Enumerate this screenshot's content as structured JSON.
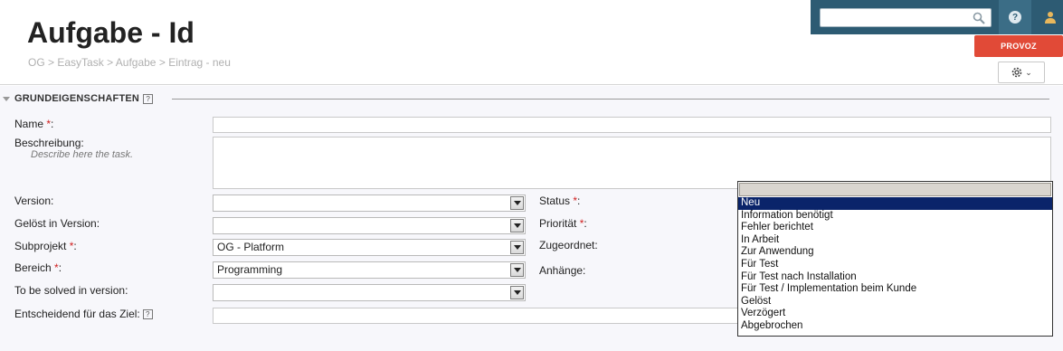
{
  "page": {
    "title": "Aufgabe - Id",
    "breadcrumb": [
      "OG",
      "EasyTask",
      "Aufgabe",
      "Eintrag - neu"
    ],
    "breadcrumb_separator": ">"
  },
  "topbar": {
    "search_placeholder": "",
    "help_icon": "question-circle-icon",
    "user_icon": "user-icon",
    "environment_badge": "PROVOZ",
    "gear_icon": "gear-icon"
  },
  "section": {
    "title": "GRUNDEIGENSCHAFTEN",
    "help_glyph": "?"
  },
  "fields": {
    "name": {
      "label": "Name",
      "required": "*",
      "suffix": ":",
      "value": ""
    },
    "beschreibung": {
      "label": "Beschreibung:",
      "hint": "Describe here the task.",
      "value": ""
    },
    "version": {
      "label": "Version:",
      "value": ""
    },
    "geloest_in_version": {
      "label": "Gelöst in Version:",
      "value": ""
    },
    "subprojekt": {
      "label": "Subprojekt",
      "required": "*",
      "suffix": ":",
      "value": "OG - Platform"
    },
    "bereich": {
      "label": "Bereich",
      "required": "*",
      "suffix": ":",
      "value": "Programming"
    },
    "to_be_solved": {
      "label": "To be solved in version:",
      "value": ""
    },
    "entscheidend": {
      "label": "Entscheidend für  das Ziel:",
      "help_glyph": "?",
      "value": ""
    },
    "status": {
      "label": "Status",
      "required": "*",
      "suffix": ":"
    },
    "prioritaet": {
      "label": "Priorität",
      "required": "*",
      "suffix": ":"
    },
    "zugeordnet": {
      "label": "Zugeordnet:"
    },
    "anhaenge": {
      "label": "Anhänge:"
    }
  },
  "status_dropdown": {
    "selected": "",
    "options": [
      "Neu",
      "Information benötigt",
      "Fehler berichtet",
      "In Arbeit",
      "Zur Anwendung",
      "Für Test",
      "Für Test nach Installation",
      "Für Test / Implementation beim Kunde",
      "Gelöst",
      "Verzögert",
      "Abgebrochen"
    ],
    "highlighted": "Neu"
  },
  "colors": {
    "topbar": "#2d5b73",
    "provoz": "#e14a37",
    "required": "#d02020",
    "highlight": "#0a246a"
  }
}
